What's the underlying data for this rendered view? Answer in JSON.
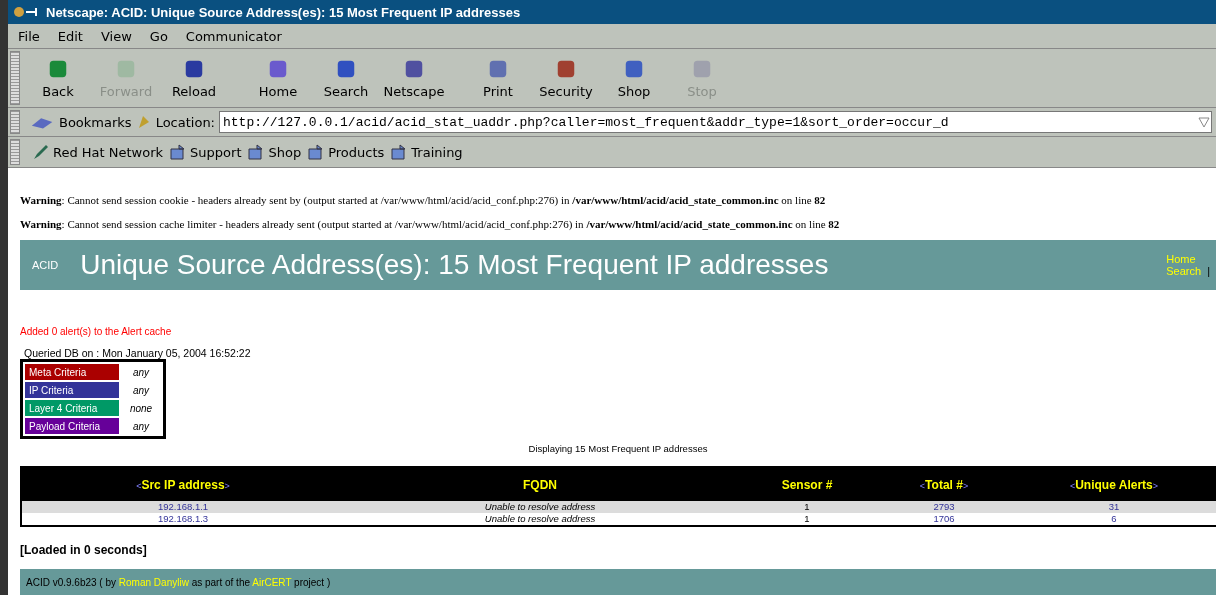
{
  "window": {
    "title": "Netscape: ACID: Unique Source Address(es): 15 Most Frequent IP addresses"
  },
  "menu": [
    "File",
    "Edit",
    "View",
    "Go",
    "Communicator"
  ],
  "toolbar": [
    {
      "label": "Back",
      "disabled": false
    },
    {
      "label": "Forward",
      "disabled": true
    },
    {
      "label": "Reload",
      "disabled": false
    },
    {
      "label": "Home",
      "disabled": false
    },
    {
      "label": "Search",
      "disabled": false
    },
    {
      "label": "Netscape",
      "disabled": false
    },
    {
      "label": "Print",
      "disabled": false
    },
    {
      "label": "Security",
      "disabled": false
    },
    {
      "label": "Shop",
      "disabled": false
    },
    {
      "label": "Stop",
      "disabled": true
    }
  ],
  "location_bar": {
    "bookmarks": "Bookmarks",
    "label": "Location:",
    "url": "http://127.0.0.1/acid/acid_stat_uaddr.php?caller=most_frequent&addr_type=1&sort_order=occur_d"
  },
  "personal_toolbar": [
    "Red Hat Network",
    "Support",
    "Shop",
    "Products",
    "Training"
  ],
  "warnings": [
    "**Warning**: Cannot send session cookie - headers already sent by (output started at /var/www/html/acid/acid_conf.php:276) in **/var/www/html/acid/acid_state_common.inc** on line **82**",
    "**Warning**: Cannot send session cache limiter - headers already sent (output started at /var/www/html/acid/acid_conf.php:276) in **/var/www/html/acid/acid_state_common.inc** on line **82**"
  ],
  "banner": {
    "logo": "ACID",
    "title": "Unique Source Address(es): 15 Most Frequent IP addresses",
    "links": [
      "Home",
      "Search"
    ],
    "separator": "|"
  },
  "cache_message": "Added 0 alert(s) to the Alert cache",
  "queried": "Queried DB on : Mon January 05, 2004 16:52:22",
  "criteria": [
    {
      "label": "Meta Criteria",
      "value": "any",
      "color": "#aa0000"
    },
    {
      "label": "IP Criteria",
      "value": "any",
      "color": "#333399"
    },
    {
      "label": "Layer 4 Criteria",
      "value": "none",
      "color": "#009966"
    },
    {
      "label": "Payload Criteria",
      "value": "any",
      "color": "#660099"
    }
  ],
  "displaying": "Displaying 15 Most Frequent IP addresses",
  "table": {
    "columns": [
      {
        "label": "Src IP address",
        "sortable": true
      },
      {
        "label": "FQDN",
        "sortable": false
      },
      {
        "label": "Sensor #",
        "sortable": false
      },
      {
        "label": "Total #",
        "sortable": true
      },
      {
        "label": "Unique Alerts",
        "sortable": true
      }
    ],
    "sort_marks": [
      "<",
      ">"
    ],
    "rows": [
      [
        "192.168.1.1",
        "Unable to resolve address",
        "1",
        "2793",
        "31"
      ],
      [
        "192.168.1.3",
        "Unable to resolve address",
        "1",
        "1706",
        "6"
      ]
    ]
  },
  "loaded": "[Loaded in 0 seconds]",
  "footer": {
    "before": "ACID v0.9.6b23 ( by",
    "author": "Roman Danyliw",
    "middle": "as part of the",
    "project": "AirCERT",
    "after": "project )"
  }
}
